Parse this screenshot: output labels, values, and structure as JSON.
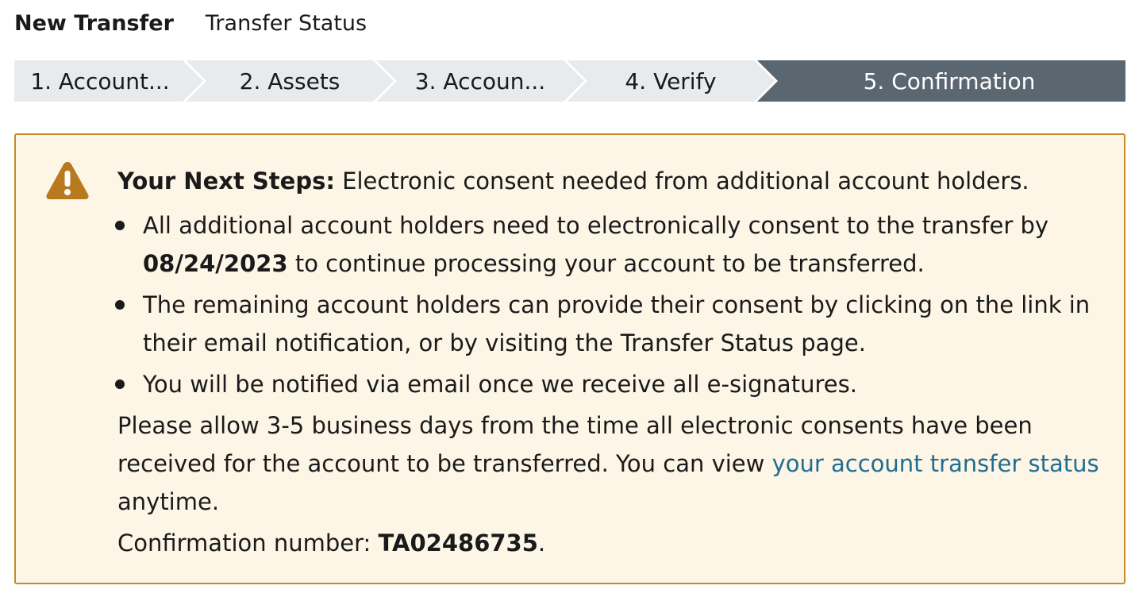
{
  "tabs": [
    {
      "label": "New Transfer",
      "active": true
    },
    {
      "label": "Transfer Status",
      "active": false
    }
  ],
  "stepper": {
    "steps": [
      {
        "label": "1. Account...",
        "state": "completed"
      },
      {
        "label": "2. Assets",
        "state": "completed"
      },
      {
        "label": "3. Accoun...",
        "state": "completed"
      },
      {
        "label": "4. Verify",
        "state": "completed"
      },
      {
        "label": "5. Confirmation",
        "state": "current"
      }
    ],
    "colors": {
      "inactive": "#e8ebee",
      "active": "#5b6770",
      "active_text": "#ffffff",
      "inactive_text": "#1a1a1a"
    }
  },
  "alert": {
    "border_color": "#c68a26",
    "background": "#fdf5e5",
    "icon": "warning-triangle-icon",
    "icon_color": "#b97a1d",
    "title": "Your Next Steps:",
    "title_rest": " Electronic consent needed from additional account holders.",
    "bullets": [
      {
        "pre": "All additional account holders need to electronically consent to the transfer by ",
        "bold": "08/24/2023",
        "post": " to continue processing your account to be transferred."
      },
      {
        "pre": "The remaining account holders can provide their consent by clicking on the link in their email notification, or by visiting the Transfer Status page.",
        "bold": "",
        "post": ""
      },
      {
        "pre": "You will be notified via email once we receive all e-signatures.",
        "bold": "",
        "post": ""
      }
    ],
    "paragraph_pre": "Please allow 3-5 business days from the time all electronic consents have been received for the account to be transferred. You can view ",
    "paragraph_link": "your account transfer status",
    "paragraph_post": " anytime.",
    "confirmation_label": "Confirmation number: ",
    "confirmation_number": "TA02486735",
    "confirmation_end": "."
  }
}
